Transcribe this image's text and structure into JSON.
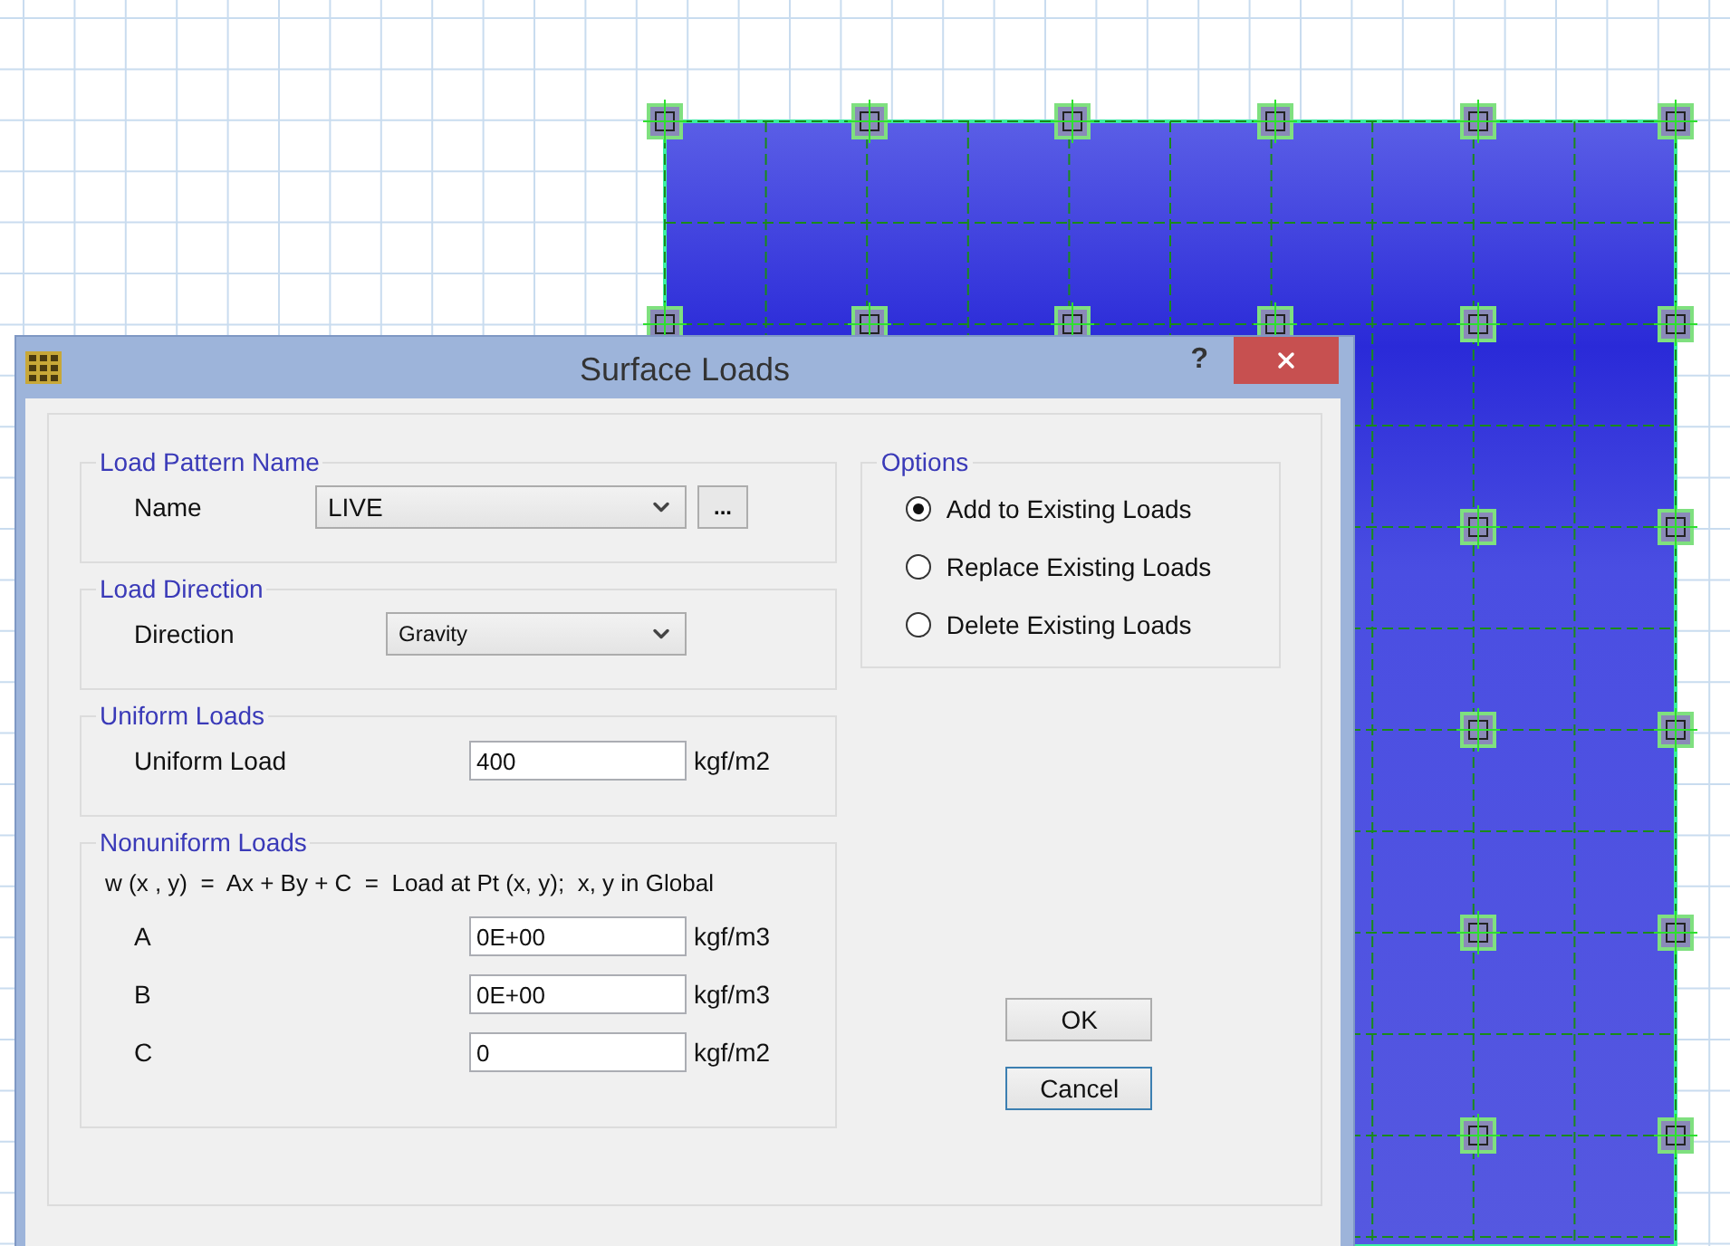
{
  "window": {
    "title": "Surface Loads",
    "help": "?"
  },
  "load_pattern": {
    "title": "Load Pattern Name",
    "label": "Name",
    "value": "LIVE",
    "browse": "..."
  },
  "load_direction": {
    "title": "Load Direction",
    "label": "Direction",
    "value": "Gravity"
  },
  "uniform_loads": {
    "title": "Uniform Loads",
    "label": "Uniform Load",
    "value": "400",
    "unit": "kgf/m2"
  },
  "nonuniform_loads": {
    "title": "Nonuniform Loads",
    "formula": "w (x , y)  =  Ax + By + C  =  Load at Pt (x, y);  x, y in Global",
    "rows": [
      {
        "label": "A",
        "value": "0E+00",
        "unit": "kgf/m3"
      },
      {
        "label": "B",
        "value": "0E+00",
        "unit": "kgf/m3"
      },
      {
        "label": "C",
        "value": "0",
        "unit": "kgf/m2"
      }
    ]
  },
  "options": {
    "title": "Options",
    "choices": [
      {
        "label": "Add to Existing Loads",
        "selected": true
      },
      {
        "label": "Replace Existing Loads",
        "selected": false
      },
      {
        "label": "Delete Existing Loads",
        "selected": false
      }
    ]
  },
  "buttons": [
    {
      "label": "OK",
      "focused": false
    },
    {
      "label": "Cancel",
      "focused": true
    }
  ]
}
